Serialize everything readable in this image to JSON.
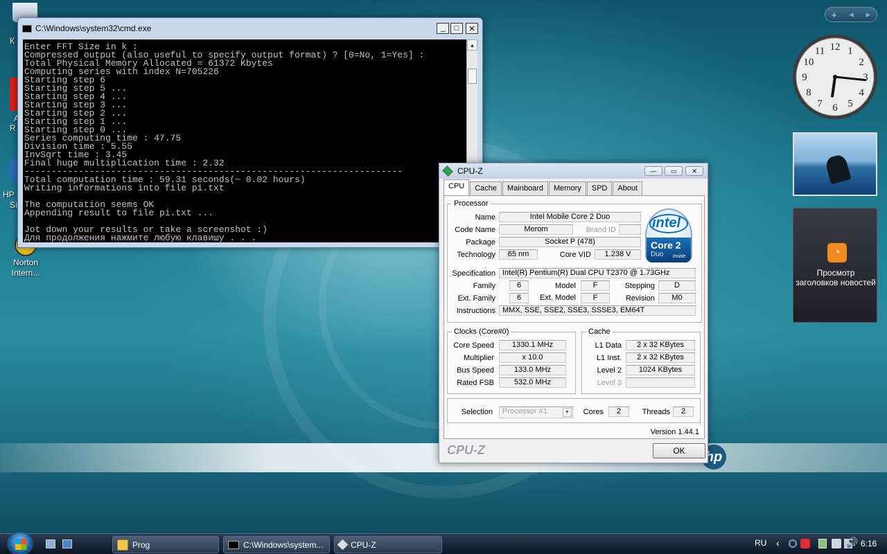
{
  "desktop": {
    "icons": [
      {
        "label": "Norton Intern..."
      }
    ],
    "partial_labels": [
      "К",
      "A",
      "R",
      "HP",
      "Sı"
    ]
  },
  "cmd_window": {
    "title": "C:\\Windows\\system32\\cmd.exe",
    "lines": [
      "Enter FFT Size in k :",
      "Compressed output (also useful to specify output format) ? [0=No, 1=Yes] :",
      "Total Physical Memory Allocated = 61372 Kbytes",
      "Computing series with index N=705226",
      "Starting step 6",
      "Starting step 5 ...",
      "Starting step 4 ...",
      "Starting step 3 ...",
      "Starting step 2 ...",
      "Starting step 1 ...",
      "Starting step 0 ...",
      "Series computing time : 47.75",
      "Division time : 5.55",
      "InvSqrt time : 3.45",
      "Final huge multiplication time : 2.32",
      "----------------------------------------------------------------------",
      "Total computation time : 59.31 seconds(~ 0.02 hours)",
      "Writing informations into file pi.txt",
      "",
      "The computation seems OK",
      "Appending result to file pi.txt ...",
      "",
      "Jot down your results or take a screenshot :)",
      "Для продолжения нажмите любую клавишу . . ."
    ]
  },
  "cpuz": {
    "title": "CPU-Z",
    "tabs": [
      "CPU",
      "Cache",
      "Mainboard",
      "Memory",
      "SPD",
      "About"
    ],
    "active_tab": "CPU",
    "processor": {
      "legend": "Processor",
      "name_label": "Name",
      "name": "Intel Mobile Core 2 Duo",
      "codename_label": "Code Name",
      "codename": "Merom",
      "brandid_label": "Brand ID",
      "package_label": "Package",
      "package": "Socket P (478)",
      "technology_label": "Technology",
      "technology": "65 nm",
      "corevid_label": "Core VID",
      "corevid": "1.238 V",
      "spec_label": "Specification",
      "spec": "Intel(R) Pentium(R) Dual  CPU  T2370  @ 1.73GHz",
      "family_label": "Family",
      "family": "6",
      "model_label": "Model",
      "model": "F",
      "stepping_label": "Stepping",
      "stepping": "D",
      "extfamily_label": "Ext. Family",
      "extfamily": "6",
      "extmodel_label": "Ext. Model",
      "extmodel": "F",
      "revision_label": "Revision",
      "revision": "M0",
      "instructions_label": "Instructions",
      "instructions": "MMX, SSE, SSE2, SSE3, SSSE3, EM64T"
    },
    "logo": {
      "brand": "intel",
      "line1": "Core 2",
      "line2": "Duo",
      "tag": "inside"
    },
    "clocks": {
      "legend": "Clocks (Core#0)",
      "corespeed_label": "Core Speed",
      "corespeed": "1330.1 MHz",
      "multiplier_label": "Multiplier",
      "multiplier": "x 10.0",
      "busspeed_label": "Bus Speed",
      "busspeed": "133.0 MHz",
      "ratedfsb_label": "Rated FSB",
      "ratedfsb": "532.0 MHz"
    },
    "cache": {
      "legend": "Cache",
      "l1data_label": "L1 Data",
      "l1data": "2 x 32 KBytes",
      "l1inst_label": "L1 Inst.",
      "l1inst": "2 x 32 KBytes",
      "level2_label": "Level 2",
      "level2": "1024 KBytes",
      "level3_label": "Level 3"
    },
    "selection_label": "Selection",
    "selection": "Processor #1",
    "cores_label": "Cores",
    "cores": "2",
    "threads_label": "Threads",
    "threads": "2",
    "version": "Version 1.44.1",
    "footer_brand": "CPU-Z",
    "ok_label": "OK"
  },
  "sidebar": {
    "rss_label": "Просмотр заголовков новостей"
  },
  "clock": {
    "hour": 6,
    "minute": 16
  },
  "taskbar": {
    "buttons": [
      {
        "label": "Prog"
      },
      {
        "label": "C:\\Windows\\system..."
      },
      {
        "label": "CPU-Z"
      }
    ],
    "lang": "RU",
    "time": "6:16"
  },
  "colors": {
    "accent": "#0071c5",
    "rss": "#f28a1f"
  }
}
